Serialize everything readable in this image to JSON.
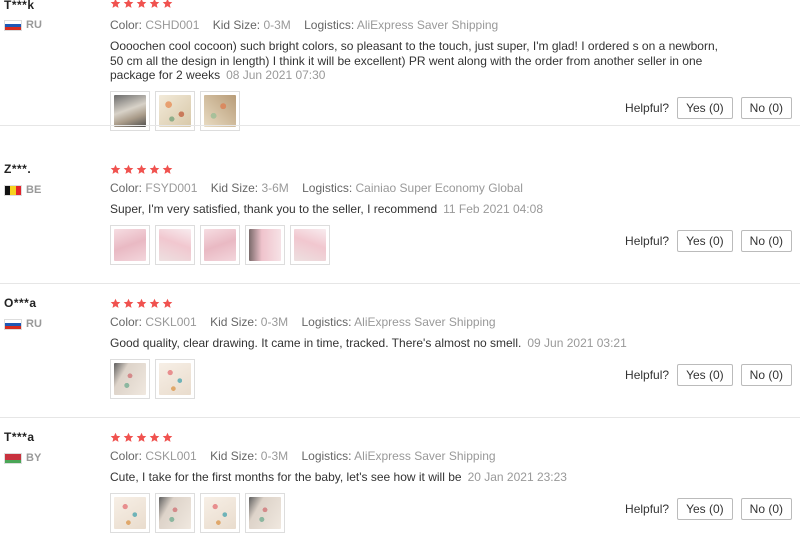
{
  "colors": {
    "star": "#f0524f",
    "muted": "#999999",
    "border": "#bbbbbb"
  },
  "helpful_label": "Helpful?",
  "reviews": [
    {
      "user": "T***k",
      "country": "RU",
      "flag": "russia",
      "stars": 5,
      "color_label": "Color:",
      "color_value": "CSHD001",
      "size_label": "Kid Size:",
      "size_value": "0-3M",
      "logistics_label": "Logistics:",
      "logistics_value": "AliExpress Saver Shipping",
      "text": "Oooochen cool cocoon) such bright colors, so pleasant to the touch, just super, I'm glad! I ordered s on a newborn, 50 cm all the design in length) I think it will be excellent) PR went along with the order from another seller in one package for 2 weeks",
      "date": "08 Jun 2021 07:30",
      "thumbnails": [
        "photo-thumbnail",
        "photo-thumbnail",
        "photo-thumbnail"
      ],
      "yes": "Yes (0)",
      "no": "No (0)"
    },
    {
      "user": "Z***.",
      "country": "BE",
      "flag": "belgium",
      "stars": 5,
      "color_label": "Color:",
      "color_value": "FSYD001",
      "size_label": "Kid Size:",
      "size_value": "3-6M",
      "logistics_label": "Logistics:",
      "logistics_value": "Cainiao Super Economy Global",
      "text": "Super, I'm very satisfied, thank you to the seller, I recommend",
      "date": "11 Feb 2021 04:08",
      "thumbnails": [
        "photo-thumbnail",
        "photo-thumbnail",
        "photo-thumbnail",
        "photo-thumbnail",
        "photo-thumbnail"
      ],
      "yes": "Yes (0)",
      "no": "No (0)"
    },
    {
      "user": "O***a",
      "country": "RU",
      "flag": "russia",
      "stars": 5,
      "color_label": "Color:",
      "color_value": "CSKL001",
      "size_label": "Kid Size:",
      "size_value": "0-3M",
      "logistics_label": "Logistics:",
      "logistics_value": "AliExpress Saver Shipping",
      "text": "Good quality, clear drawing. It came in time, tracked. There's almost no smell.",
      "date": "09 Jun 2021 03:21",
      "thumbnails": [
        "photo-thumbnail",
        "photo-thumbnail"
      ],
      "yes": "Yes (0)",
      "no": "No (0)"
    },
    {
      "user": "T***a",
      "country": "BY",
      "flag": "belarus",
      "stars": 5,
      "color_label": "Color:",
      "color_value": "CSKL001",
      "size_label": "Kid Size:",
      "size_value": "0-3M",
      "logistics_label": "Logistics:",
      "logistics_value": "AliExpress Saver Shipping",
      "text": "Cute, I take for the first months for the baby, let's see how it will be",
      "date": "20 Jan 2021 23:23",
      "thumbnails": [
        "photo-thumbnail",
        "photo-thumbnail",
        "photo-thumbnail",
        "photo-thumbnail"
      ],
      "yes": "Yes (0)",
      "no": "No (0)"
    }
  ]
}
